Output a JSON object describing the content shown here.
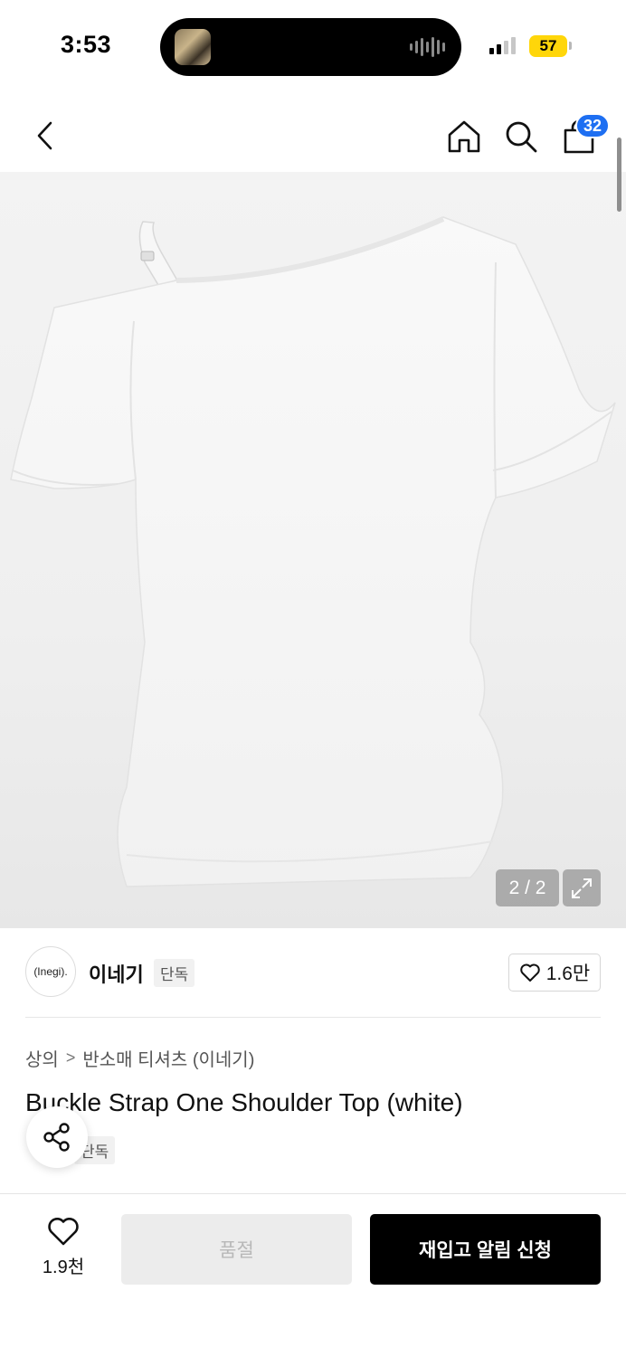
{
  "status_bar": {
    "time": "3:53",
    "battery": "57"
  },
  "header": {
    "cart_count": "32"
  },
  "gallery": {
    "counter": "2 / 2"
  },
  "brand": {
    "logo_text": "(Inegi).",
    "name": "이네기",
    "exclusive_tag": "단독",
    "like_count": "1.6만"
  },
  "breadcrumb": {
    "category": "상의",
    "subcategory": "반소매 티셔츠 (이네기)"
  },
  "product": {
    "title": "Buckle Strap One Shoulder Top (white)",
    "tag": "단독"
  },
  "bottom_bar": {
    "wish_count": "1.9천",
    "soldout_label": "품절",
    "restock_label": "재입고 알림 신청"
  },
  "colors": {
    "badge": "#1e6ff2",
    "battery": "#ffd60a",
    "primary_button": "#000000"
  },
  "icons": [
    "back-icon",
    "home-icon",
    "search-icon",
    "cart-icon",
    "expand-icon",
    "heart-icon",
    "share-icon"
  ]
}
